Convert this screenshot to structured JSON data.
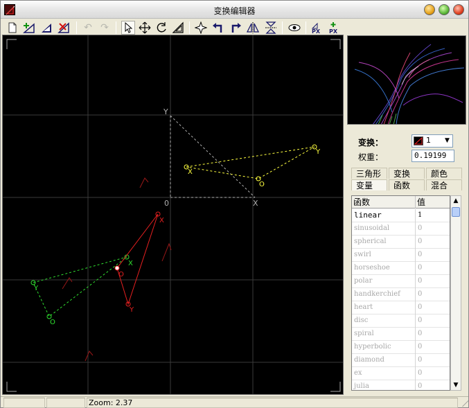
{
  "window": {
    "title": "变换编辑器"
  },
  "toolbar": {
    "items": [
      "new-icon",
      "add-icon",
      "duplicate-icon",
      "delete-icon",
      "undo-icon",
      "redo-icon",
      "select-icon",
      "move-icon",
      "rotate-icon",
      "scale-icon",
      "center-icon",
      "rotate-left-icon",
      "rotate-right-icon",
      "flip-horizontal-icon",
      "flip-vertical-icon",
      "visibility-icon",
      "post-transform-icon",
      "post-transform-add-icon"
    ]
  },
  "canvas": {
    "origin_label": "0",
    "y_label": "Y",
    "x_label": "X",
    "o_label": "O",
    "colors": {
      "grid": "#3c3c3c",
      "reference": "#b0b0b0",
      "transform_yellow": "#ffff40",
      "transform_green": "#30e030",
      "transform_red": "#e82020"
    }
  },
  "panel": {
    "transform_label": "变换：",
    "transform_value": "1",
    "weight_label": "权重：",
    "weight_value": "0.19199"
  },
  "tabs": {
    "row1": [
      "三角形",
      "变换",
      "颜色"
    ],
    "row2": [
      "变量",
      "函数",
      "混合"
    ]
  },
  "variations": {
    "header_name": "函数",
    "header_value": "值",
    "rows": [
      {
        "name": "linear",
        "value": "1"
      },
      {
        "name": "sinusoidal",
        "value": "0"
      },
      {
        "name": "spherical",
        "value": "0"
      },
      {
        "name": "swirl",
        "value": "0"
      },
      {
        "name": "horseshoe",
        "value": "0"
      },
      {
        "name": "polar",
        "value": "0"
      },
      {
        "name": "handkerchief",
        "value": "0"
      },
      {
        "name": "heart",
        "value": "0"
      },
      {
        "name": "disc",
        "value": "0"
      },
      {
        "name": "spiral",
        "value": "0"
      },
      {
        "name": "hyperbolic",
        "value": "0"
      },
      {
        "name": "diamond",
        "value": "0"
      },
      {
        "name": "ex",
        "value": "0"
      },
      {
        "name": "julia",
        "value": "0"
      }
    ]
  },
  "statusbar": {
    "zoom": "Zoom: 2.37"
  }
}
